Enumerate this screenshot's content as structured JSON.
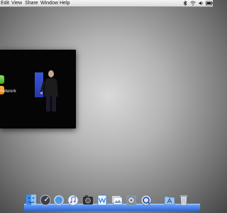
{
  "menubar": {
    "items": [
      "Edit",
      "View",
      "Share",
      "Window",
      "Help"
    ]
  },
  "video": {
    "caption": "network"
  },
  "dock": {
    "items": [
      {
        "name": "finder-icon"
      },
      {
        "name": "dashboard-icon"
      },
      {
        "name": "safari-icon"
      },
      {
        "name": "itunes-icon"
      },
      {
        "name": "photo-booth-icon"
      },
      {
        "name": "iweb-icon"
      },
      {
        "name": "preview-icon"
      },
      {
        "name": "system-preferences-icon"
      },
      {
        "name": "quicktime-icon"
      },
      {
        "name": "applications-folder-icon"
      },
      {
        "name": "trash-icon"
      }
    ]
  },
  "colors": {
    "dock_shelf": "#3b78e7",
    "video_background": "#050505",
    "presentation_blue": "#3148c9"
  }
}
